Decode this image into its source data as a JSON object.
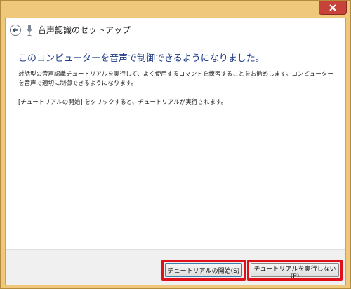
{
  "window": {
    "title": "音声認識のセットアップ"
  },
  "content": {
    "heading": "このコンピューターを音声で制御できるようになりました。",
    "body": "対話型の音声認識チュートリアルを実行して、よく使用するコマンドを練習することをお勧めします。コンピューターを音声で適切に制御できるようになります。",
    "hint": "[チュートリアルの開始] をクリックすると、チュートリアルが実行されます。"
  },
  "buttons": {
    "start_label": "チュートリアルの開始(S)",
    "skip_label": "チュートリアルを実行しない(P)"
  },
  "colors": {
    "frame": "#f0c87c",
    "close": "#c7433a",
    "heading": "#1f3c88",
    "highlight": "#e0101a"
  },
  "icons": {
    "close": "close-icon",
    "back": "back-arrow-icon",
    "microphone": "microphone-icon"
  }
}
